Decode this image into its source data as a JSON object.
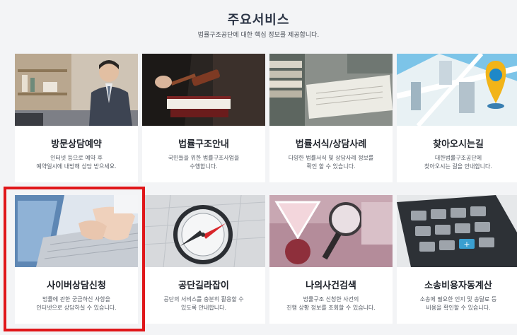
{
  "header": {
    "title": "주요서비스",
    "subtitle": "법률구조공단에 대한 핵심 정보를 제공합니다."
  },
  "services": [
    {
      "title": "방문상담예약",
      "desc": [
        "인터넷 등으로 예약 후",
        "예약일시에 내방해 상담 받으세요."
      ],
      "icon": "consultation-photo"
    },
    {
      "title": "법률구조안내",
      "desc": [
        "국민들을 위한 법률구조사업을",
        "수행합니다."
      ],
      "icon": "gavel-photo"
    },
    {
      "title": "법률서식/상담사례",
      "desc": [
        "다양한 법률서식 및 상담사례 정보를",
        "확인 할 수 있습니다."
      ],
      "icon": "books-photo"
    },
    {
      "title": "찾아오시는길",
      "desc": [
        "대한법률구조공단에",
        "찾아오시는 길을 안내합니다."
      ],
      "icon": "map-pin-photo"
    },
    {
      "title": "사이버상담신청",
      "desc": [
        "법률에 관한 궁금하신 사항을",
        "인터넷으로 상담하실 수 있습니다."
      ],
      "icon": "laptop-typing-photo"
    },
    {
      "title": "공단길라잡이",
      "desc": [
        "공단의 서비스를 충분히 활용할 수",
        "있도록 안내합니다."
      ],
      "icon": "compass-photo"
    },
    {
      "title": "나의사건검색",
      "desc": [
        "법률구조 신청한 사건의",
        "진행 상황 정보를 조회할 수 있습니다."
      ],
      "icon": "magnifier-photo"
    },
    {
      "title": "소송비용자동계산",
      "desc": [
        "소송에 필요한 인지 및 송달료 등",
        "비용을 확인할 수 있습니다."
      ],
      "icon": "calculator-photo"
    }
  ],
  "colors": {
    "highlight_border": "#e0171a",
    "title_text": "#2b3445",
    "card_background": "#ffffff"
  }
}
